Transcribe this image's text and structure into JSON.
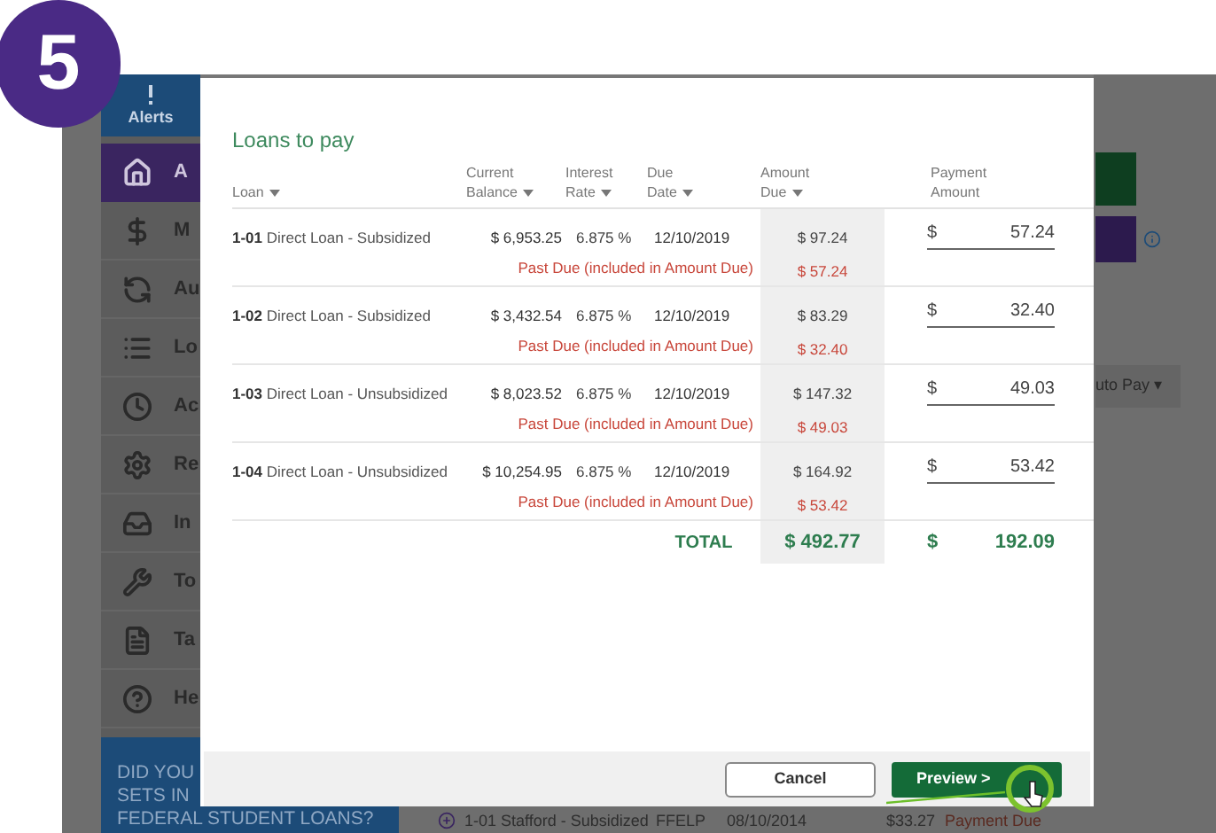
{
  "step_badge": "5",
  "background": {
    "alerts": "Alerts",
    "sidebar": [
      {
        "label": "A",
        "selected": true
      },
      {
        "label": "M",
        "selected": false
      },
      {
        "label": "Au",
        "selected": false
      },
      {
        "label": "Lo",
        "selected": false
      },
      {
        "label": "Ac",
        "selected": false
      },
      {
        "label": "Re",
        "selected": false
      },
      {
        "label": "In",
        "selected": false
      },
      {
        "label": "To",
        "selected": false
      },
      {
        "label": "Ta",
        "selected": false
      },
      {
        "label": "He",
        "selected": false
      }
    ],
    "promo": [
      "DID YOU",
      "SETS IN",
      "FEDERAL STUDENT LOANS?"
    ],
    "auto_pay": "uto Pay ▾",
    "loan_row": {
      "name": "1-01 Stafford - Subsidized",
      "program": "FFELP",
      "date": "08/10/2014",
      "amount": "$33.27",
      "status": "Payment Due"
    }
  },
  "modal": {
    "title": "Loans to pay",
    "columns": [
      {
        "lines": [
          "Loan"
        ],
        "sortable": true
      },
      {
        "lines": [
          "Current",
          "Balance"
        ],
        "sortable": true
      },
      {
        "lines": [
          "Interest",
          "Rate"
        ],
        "sortable": true
      },
      {
        "lines": [
          "Due",
          "Date"
        ],
        "sortable": true
      },
      {
        "lines": [
          "Amount",
          "Due"
        ],
        "sortable": true
      },
      {
        "lines": [
          "Payment",
          "Amount"
        ],
        "sortable": false
      }
    ],
    "loans": [
      {
        "id": "1-01",
        "name": "Direct Loan - Subsidized",
        "balance": "$ 6,953.25",
        "rate": "6.875 %",
        "due_date": "12/10/2019",
        "amount_due": "$ 97.24",
        "past_due_label": "Past Due (included in Amount Due)",
        "past_due_amount": "$ 57.24",
        "currency": "$",
        "payment": "57.24"
      },
      {
        "id": "1-02",
        "name": "Direct Loan - Subsidized",
        "balance": "$ 3,432.54",
        "rate": "6.875 %",
        "due_date": "12/10/2019",
        "amount_due": "$ 83.29",
        "past_due_label": "Past Due (included in Amount Due)",
        "past_due_amount": "$ 32.40",
        "currency": "$",
        "payment": "32.40"
      },
      {
        "id": "1-03",
        "name": "Direct Loan - Unsubsidized",
        "balance": "$ 8,023.52",
        "rate": "6.875 %",
        "due_date": "12/10/2019",
        "amount_due": "$ 147.32",
        "past_due_label": "Past Due (included in Amount Due)",
        "past_due_amount": "$ 49.03",
        "currency": "$",
        "payment": "49.03"
      },
      {
        "id": "1-04",
        "name": "Direct Loan - Unsubsidized",
        "balance": "$ 10,254.95",
        "rate": "6.875 %",
        "due_date": "12/10/2019",
        "amount_due": "$ 164.92",
        "past_due_label": "Past Due (included in Amount Due)",
        "past_due_amount": "$ 53.42",
        "currency": "$",
        "payment": "53.42"
      }
    ],
    "total": {
      "label": "TOTAL",
      "amount_due": "$ 492.77",
      "currency": "$",
      "payment": "192.09"
    },
    "buttons": [
      {
        "label": "Cancel",
        "kind": "secondary"
      },
      {
        "label": "Preview >",
        "kind": "primary"
      }
    ]
  }
}
